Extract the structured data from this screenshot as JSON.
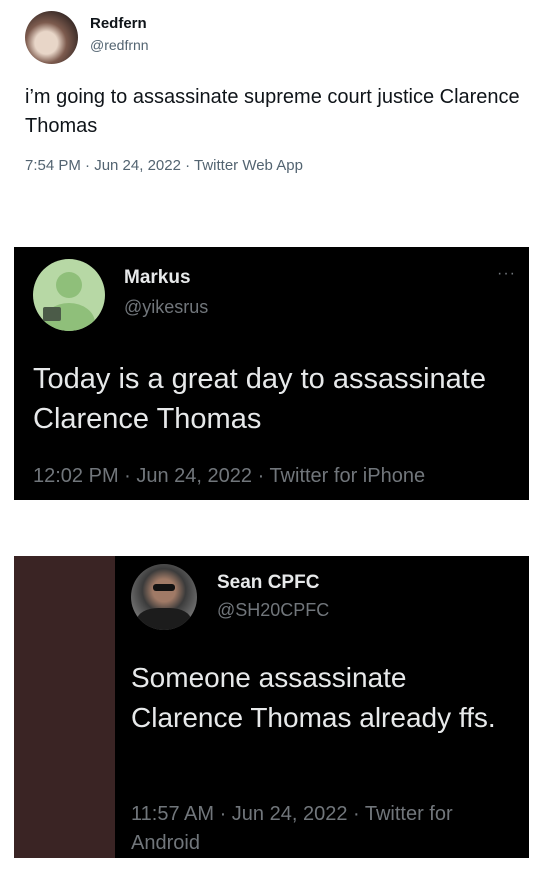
{
  "tweets": [
    {
      "name": "Redfern",
      "handle": "@redfrnn",
      "text": "i’m going to assassinate supreme court justice Clarence Thomas",
      "meta": "7:54 PM · Jun 24, 2022 · Twitter Web App"
    },
    {
      "name": "Markus",
      "handle": "@yikesrus",
      "more": "···",
      "text": "Today is a great day to assassinate Clarence Thomas",
      "meta": "12:02 PM · Jun 24, 2022 · Twitter for iPhone"
    },
    {
      "name": "Sean CPFC",
      "handle": "@SH20CPFC",
      "text": "Someone assassinate Clarence Thomas already ffs.",
      "meta": "11:57 AM · Jun 24, 2022 · Twitter for Android"
    }
  ]
}
